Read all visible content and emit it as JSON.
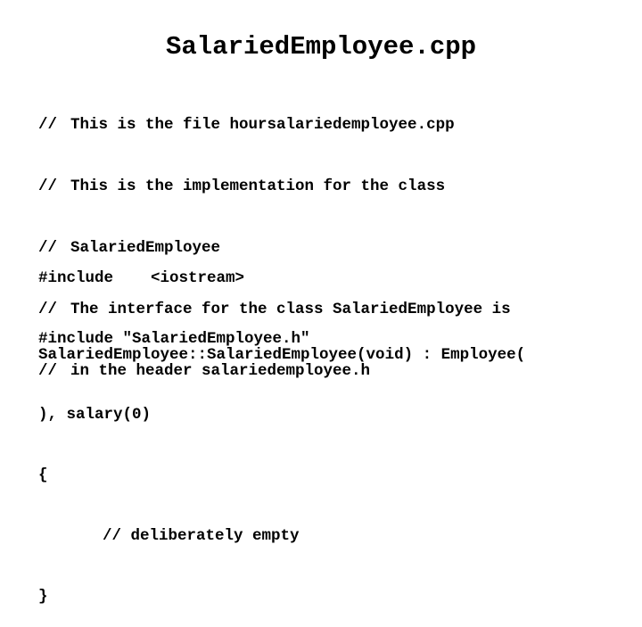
{
  "slide": {
    "title": "SalariedEmployee.cpp",
    "comment_marker": "//",
    "comment_lines": [
      "This is the file hoursalariedemployee.cpp",
      "This is the implementation for the class",
      "SalariedEmployee",
      "The interface for the class SalariedEmployee is",
      "in the header salariedemployee.h"
    ],
    "include_lines": [
      "#include    <iostream>",
      "#include \"SalariedEmployee.h\""
    ],
    "code_lines": [
      "SalariedEmployee::SalariedEmployee(void) : Employee(",
      "), salary(0)",
      "{",
      "// deliberately empty",
      "}"
    ]
  }
}
